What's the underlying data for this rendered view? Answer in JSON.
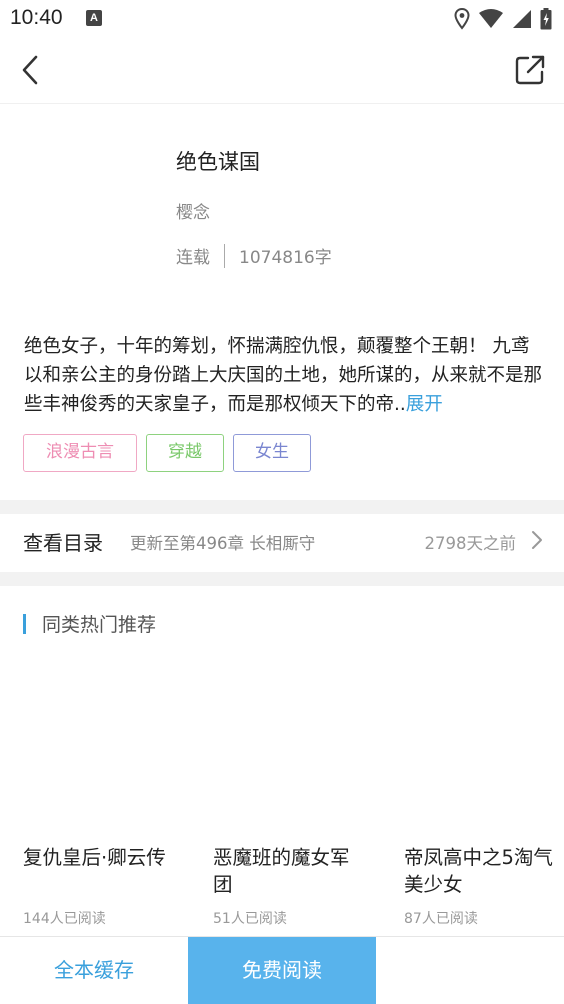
{
  "status_bar": {
    "time": "10:40",
    "notification_icon": "A"
  },
  "nav": {
    "back_icon": "chevron-left-icon",
    "share_icon": "share-icon"
  },
  "book": {
    "title": "绝色谋国",
    "author": "樱念",
    "status": "连载",
    "word_count": "1074816字",
    "synopsis": "绝色女子，十年的筹划，怀揣满腔仇恨，颠覆整个王朝！ 九鸢以和亲公主的身份踏上大庆国的土地，她所谋的，从来就不是那些丰神俊秀的天家皇子，而是那权倾天下的帝..",
    "expand_label": "展开",
    "tags": [
      "浪漫古言",
      "穿越",
      "女生"
    ]
  },
  "catalog": {
    "label": "查看目录",
    "latest": "更新至第496章 长相厮守",
    "updated": "2798天之前"
  },
  "recommendations": {
    "title": "同类热门推荐",
    "items": [
      {
        "name": "复仇皇后·卿云传",
        "readers": "144人已阅读"
      },
      {
        "name": "恶魔班的魔女军团",
        "readers": "51人已阅读"
      },
      {
        "name": "帝凤高中之5淘气美少女",
        "readers": "87人已阅读"
      }
    ]
  },
  "bottom": {
    "cache_label": "全本缓存",
    "read_label": "免费阅读"
  },
  "colors": {
    "accent": "#3aa0dc",
    "primary_button": "#58b3ec",
    "tag_pink": "#ee8db3",
    "tag_green": "#7ac86a",
    "tag_purple": "#7a86d0"
  }
}
